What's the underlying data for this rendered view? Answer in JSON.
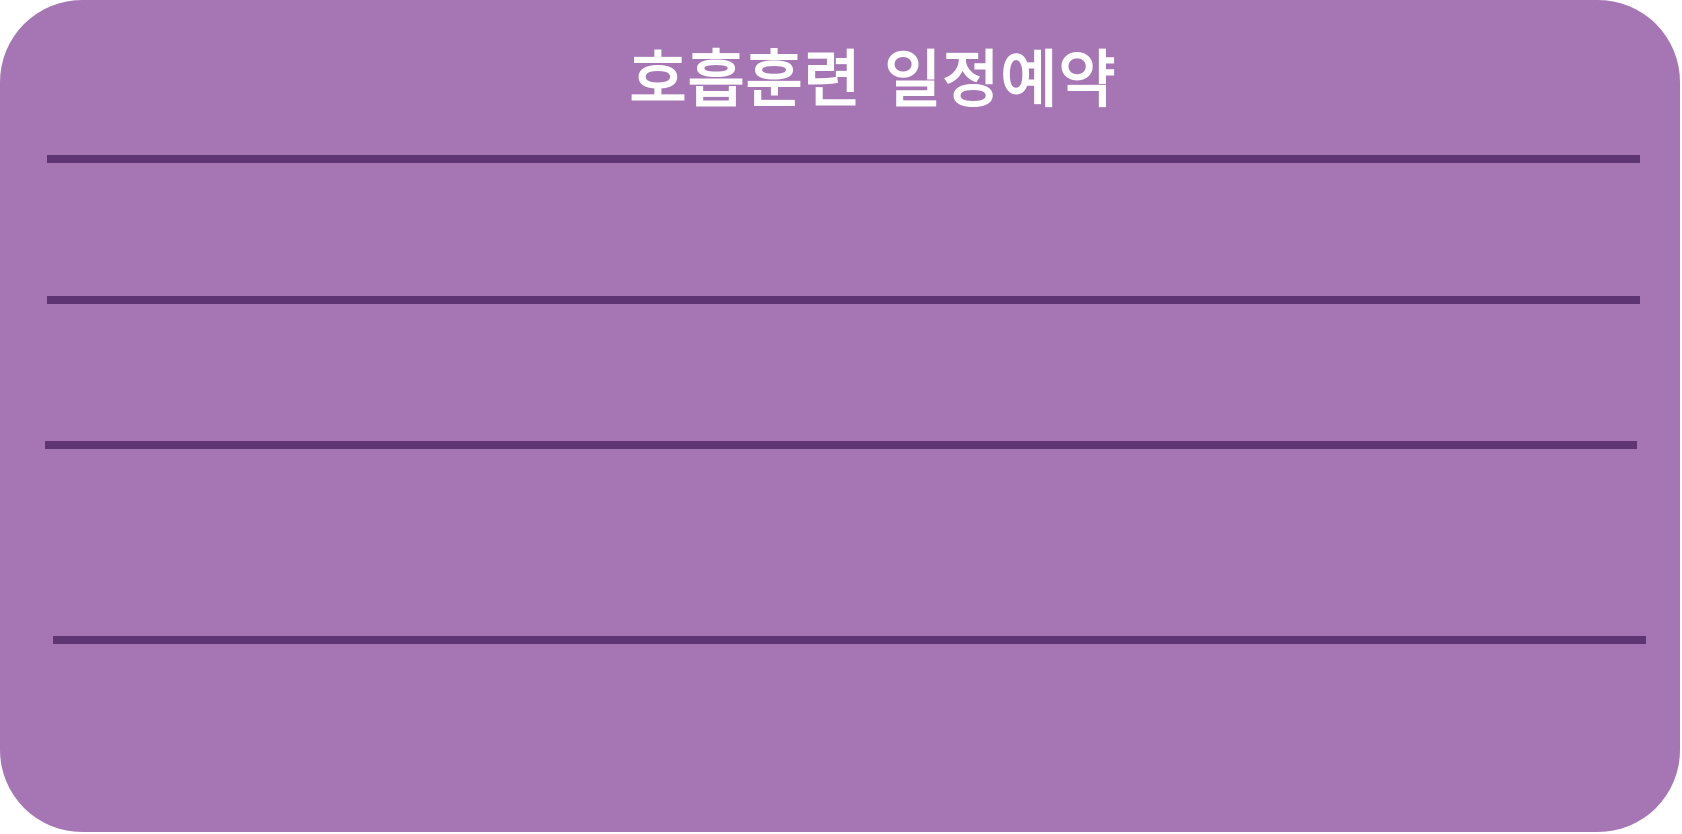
{
  "card": {
    "title": "호흡훈련 일정예약",
    "background_color": "#a576b3",
    "rule_color": "#5f3472",
    "rows": [
      {
        "value": ""
      },
      {
        "value": ""
      },
      {
        "value": ""
      }
    ]
  }
}
